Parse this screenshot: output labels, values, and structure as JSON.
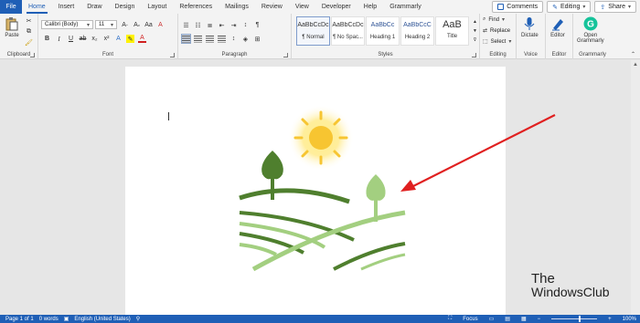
{
  "tabs": [
    "File",
    "Home",
    "Insert",
    "Draw",
    "Design",
    "Layout",
    "References",
    "Mailings",
    "Review",
    "View",
    "Developer",
    "Help",
    "Grammarly"
  ],
  "tab_active": "Home",
  "top_buttons": {
    "comments": "Comments",
    "editing": "Editing",
    "share": "Share"
  },
  "clipboard": {
    "paste": "Paste",
    "label": "Clipboard"
  },
  "font": {
    "name": "Calibri (Body)",
    "size": "11",
    "label": "Font",
    "bold": "B",
    "italic": "I",
    "underline": "U"
  },
  "paragraph": {
    "label": "Paragraph"
  },
  "styles": {
    "label": "Styles",
    "items": [
      {
        "preview": "AaBbCcDc",
        "name": "¶ Normal"
      },
      {
        "preview": "AaBbCcDc",
        "name": "¶ No Spac..."
      },
      {
        "preview": "AaBbCc",
        "name": "Heading 1"
      },
      {
        "preview": "AaBbCcC",
        "name": "Heading 2"
      },
      {
        "preview": "AaB",
        "name": "Title"
      }
    ]
  },
  "editing": {
    "find": "Find",
    "replace": "Replace",
    "select": "Select",
    "label": "Editing"
  },
  "voice": {
    "dictate": "Dictate",
    "label": "Voice"
  },
  "editor": {
    "button": "Editor",
    "label": "Editor"
  },
  "grammarly": {
    "button_line1": "Open",
    "button_line2": "Grammarly",
    "label": "Grammarly"
  },
  "status": {
    "page": "Page 1 of 1",
    "words": "0 words",
    "language": "English (United States)",
    "focus": "Focus",
    "zoom": "100%"
  },
  "watermark": {
    "line1": "The",
    "line2": "WindowsClub"
  },
  "colors": {
    "accent": "#1f5fb6",
    "sun": "#f7c531",
    "dark_green": "#4f7f2e",
    "light_green": "#a3cf80",
    "arrow": "#e02020"
  }
}
